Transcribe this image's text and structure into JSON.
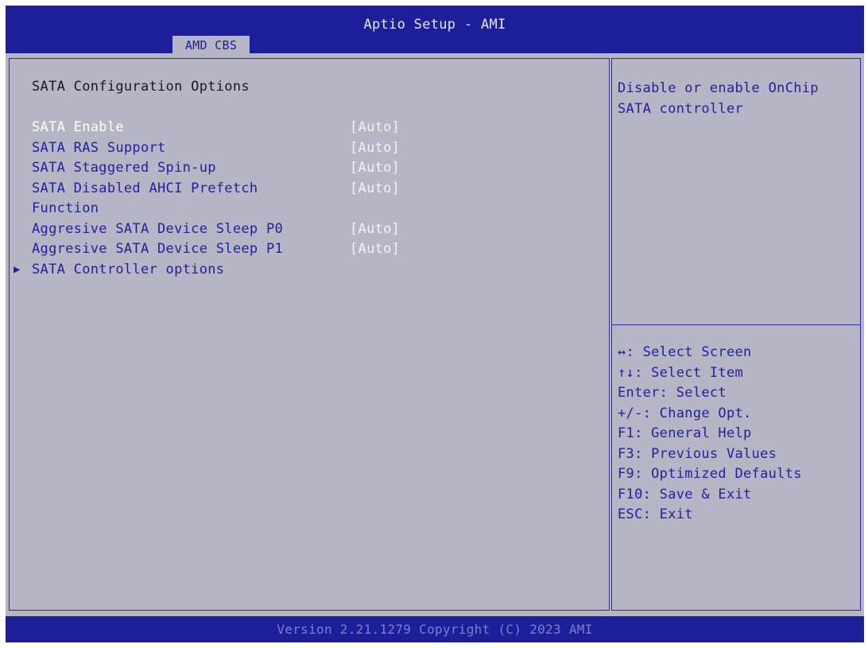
{
  "header": {
    "title": "Aptio Setup - AMI",
    "active_tab": "AMD CBS"
  },
  "page": {
    "section_title": "SATA Configuration Options",
    "options": [
      {
        "label": "SATA Enable",
        "value": "[Auto]",
        "selected": true
      },
      {
        "label": "SATA RAS Support",
        "value": "[Auto]"
      },
      {
        "label": "SATA Staggered Spin-up",
        "value": "[Auto]"
      },
      {
        "label": "SATA Disabled AHCI Prefetch",
        "label_line2": "Function",
        "value": "[Auto]"
      },
      {
        "label": "Aggresive SATA Device Sleep P0",
        "value": "[Auto]"
      },
      {
        "label": "Aggresive SATA Device Sleep P1",
        "value": "[Auto]"
      }
    ],
    "submenu": {
      "arrow": "▶",
      "label": "SATA Controller options"
    }
  },
  "help": {
    "text": "Disable or enable OnChip\nSATA controller"
  },
  "keys": [
    "↔: Select Screen",
    "↑↓: Select Item",
    "Enter: Select",
    "+/-: Change Opt.",
    "F1: General Help",
    "F3: Previous Values",
    "F9: Optimized Defaults",
    "F10: Save & Exit",
    "ESC: Exit"
  ],
  "footer": {
    "text": "Version 2.21.1279 Copyright (C) 2023 AMI"
  },
  "colors": {
    "header_bg": "#1d1f9a",
    "panel_bg": "#b5b5c6",
    "label_text": "#22229a",
    "selected_text": "#ffffff",
    "value_text": "#f2f2f2"
  }
}
